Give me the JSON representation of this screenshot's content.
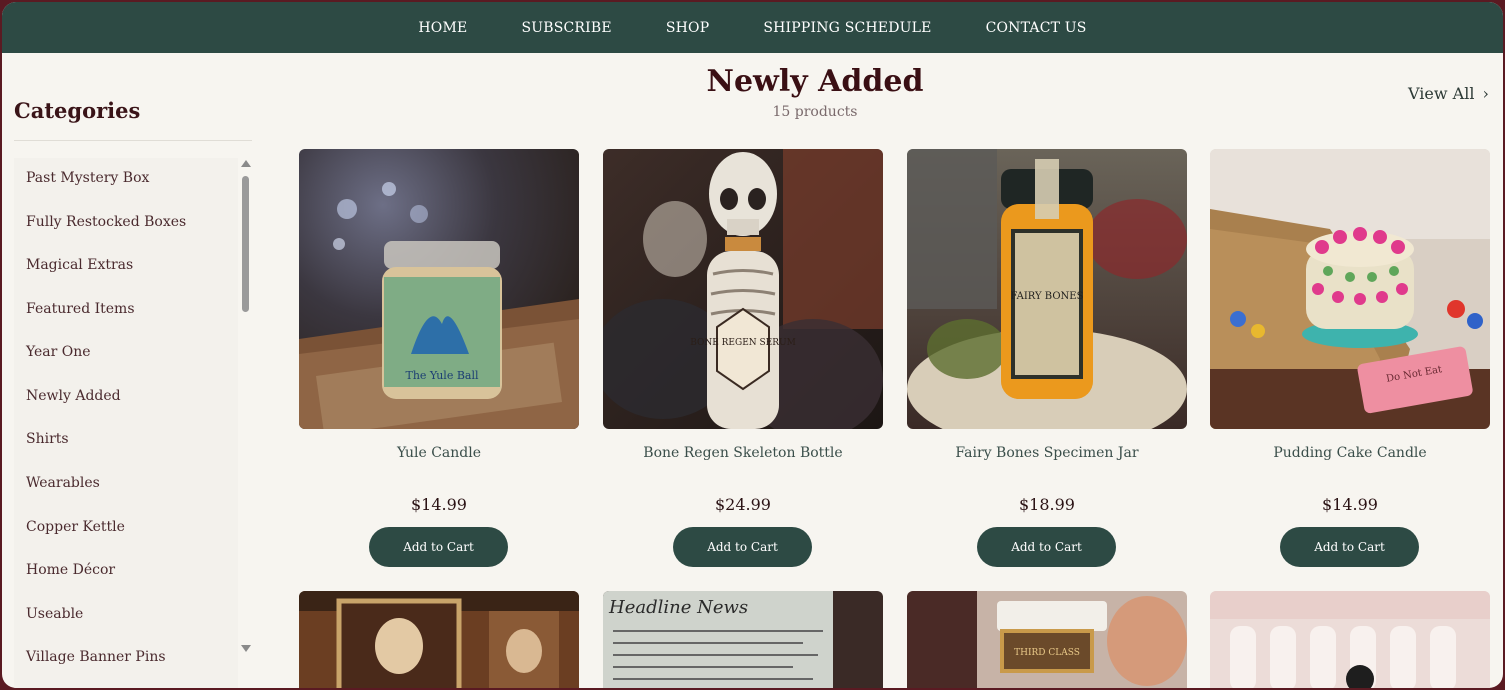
{
  "nav": {
    "items": [
      "HOME",
      "SUBSCRIBE",
      "SHOP",
      "SHIPPING SCHEDULE",
      "CONTACT US"
    ]
  },
  "sidebar": {
    "title": "Categories",
    "items": [
      "Past Mystery Box",
      "Fully Restocked Boxes",
      "Magical Extras",
      "Featured Items",
      "Year One",
      "Newly Added",
      "Shirts",
      "Wearables",
      "Copper Kettle",
      "Home Décor",
      "Useable",
      "Village Banner Pins"
    ]
  },
  "main": {
    "title": "Newly Added",
    "count": "15 products",
    "view_all": "View All",
    "add_to_cart": "Add to Cart",
    "products": [
      {
        "name": "Yule Candle",
        "price": "$14.99"
      },
      {
        "name": "Bone Regen Skeleton Bottle",
        "price": "$24.99"
      },
      {
        "name": "Fairy Bones Specimen Jar",
        "price": "$18.99"
      },
      {
        "name": "Pudding Cake Candle",
        "price": "$14.99"
      }
    ],
    "image_labels": {
      "candle": "The Yule Ball",
      "skeleton": "BONE REGEN SERUM",
      "jar": "FAIRY BONES",
      "cake_note": "Do Not Eat",
      "newspaper": "Headline News",
      "ticket": "THIRD CLASS"
    }
  },
  "colors": {
    "nav_bg": "#2d4a44",
    "page_bg": "#f7f5f0",
    "title": "#3a0f14",
    "button": "#2d4a44",
    "frame": "#5a1a22"
  }
}
